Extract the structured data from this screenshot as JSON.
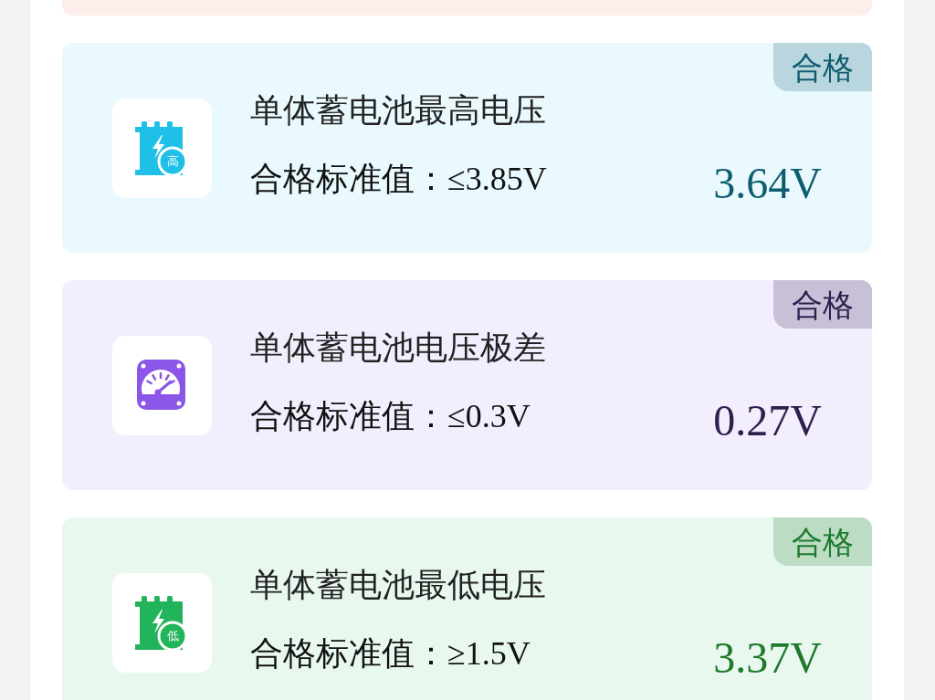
{
  "previous_card": {
    "color": "#fdeeec"
  },
  "cards": [
    {
      "title": "单体蓄电池最高电压",
      "standard": "合格标准值：≤3.85V",
      "value": "3.64V",
      "badge": "合格",
      "color": "#0f5c70",
      "icon": {
        "kind": "battery",
        "color": "#1ec0e8",
        "label": "高"
      }
    },
    {
      "title": "单体蓄电池电压极差",
      "standard": "合格标准值：≤0.3V",
      "value": "0.27V",
      "badge": "合格",
      "color": "#2e1f4f",
      "icon": {
        "kind": "gauge",
        "color": "#8a55e8"
      }
    },
    {
      "title": "单体蓄电池最低电压",
      "standard": "合格标准值：≥1.5V",
      "value": "3.37V",
      "badge": "合格",
      "color": "#1d7a2d",
      "icon": {
        "kind": "battery",
        "color": "#22b45a",
        "label": "低"
      }
    }
  ]
}
